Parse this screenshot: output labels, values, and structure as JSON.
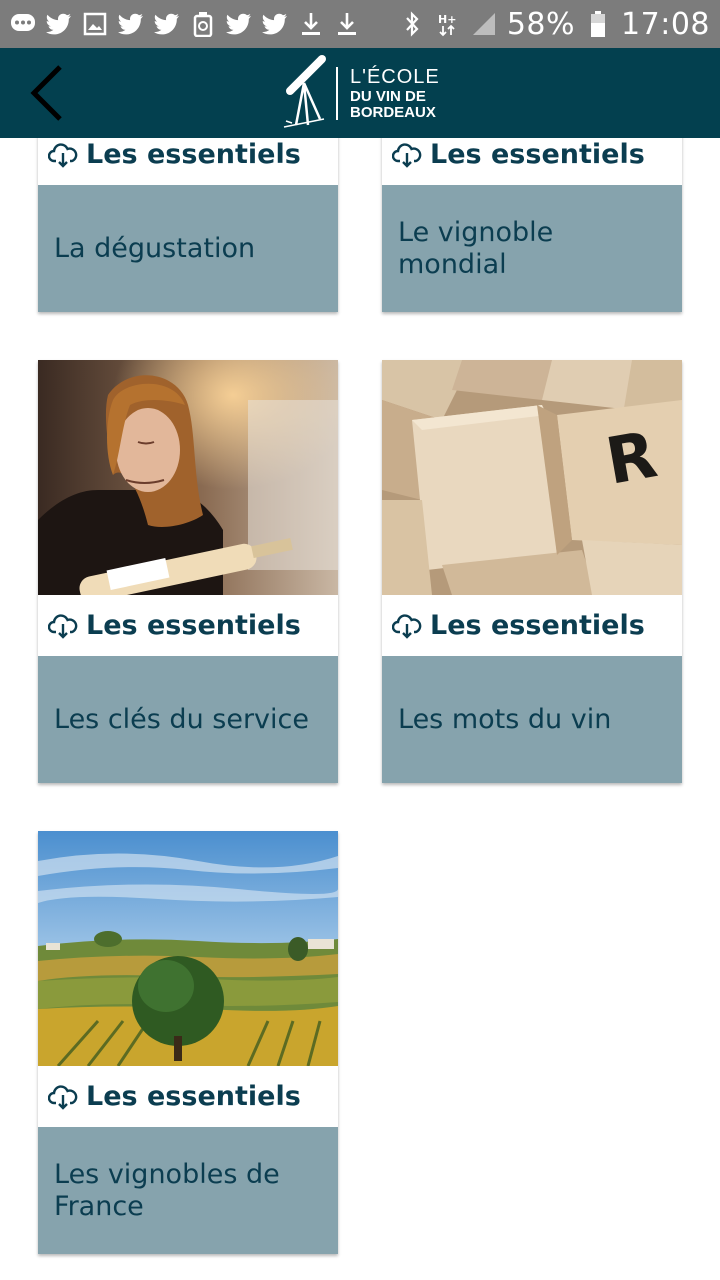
{
  "status_bar": {
    "battery_percent": "58%",
    "time": "17:08",
    "icons": [
      "messages-icon",
      "twitter-icon",
      "image-icon",
      "twitter-icon",
      "twitter-icon",
      "recycle-icon",
      "twitter-icon",
      "twitter-icon",
      "download-icon",
      "download-icon",
      "bluetooth-icon",
      "hplus-signal-icon",
      "cell-signal-icon",
      "battery-icon"
    ]
  },
  "header": {
    "back_icon": "chevron-left-icon",
    "logo": {
      "line1": "L'ÉCOLE",
      "line2": "DU VIN DE",
      "line3": "BORDEAUX",
      "icon": "telescope-icon"
    }
  },
  "colors": {
    "header_bg": "#03404f",
    "card_body_bg": "#86a3ad",
    "card_text": "#0b3d50",
    "status_bar_bg": "#7c7c7c"
  },
  "cards": [
    {
      "badge": "Les essentiels",
      "badge_icon": "cloud-download-icon",
      "title": "La dégustation"
    },
    {
      "badge": "Les essentiels",
      "badge_icon": "cloud-download-icon",
      "title": "Le vignoble mondial"
    },
    {
      "badge": "Les essentiels",
      "badge_icon": "cloud-download-icon",
      "title": "Les clés du service",
      "image": "woman-pouring-wine-photo"
    },
    {
      "badge": "Les essentiels",
      "badge_icon": "cloud-download-icon",
      "title": "Les mots du vin",
      "image": "wooden-letter-tiles-photo"
    },
    {
      "badge": "Les essentiels",
      "badge_icon": "cloud-download-icon",
      "title": "Les vignobles de France",
      "image": "vineyard-landscape-photo"
    }
  ]
}
